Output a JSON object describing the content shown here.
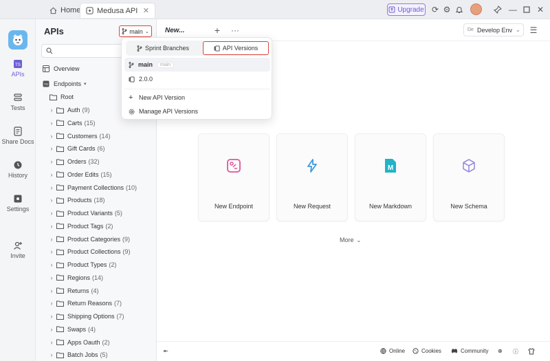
{
  "titlebar": {
    "tabs": [
      {
        "label": "Home",
        "icon": "home-icon"
      },
      {
        "label": "Medusa API",
        "icon": "project-icon",
        "active": true
      }
    ],
    "upgrade_label": "Upgrade"
  },
  "rail": {
    "items": [
      {
        "label": "APIs",
        "icon": "api-icon",
        "active": true
      },
      {
        "label": "Tests",
        "icon": "tests-icon"
      },
      {
        "label": "Share Docs",
        "icon": "docs-icon"
      },
      {
        "label": "History",
        "icon": "history-icon"
      },
      {
        "label": "Settings",
        "icon": "settings-icon"
      },
      {
        "label": "Invite",
        "icon": "invite-icon"
      }
    ]
  },
  "explorer": {
    "title": "APIs",
    "branch_label": "main",
    "overview_label": "Overview",
    "endpoints_label": "Endpoints",
    "root_label": "Root",
    "folders": [
      {
        "name": "Auth",
        "count": "(9)"
      },
      {
        "name": "Carts",
        "count": "(15)"
      },
      {
        "name": "Customers",
        "count": "(14)"
      },
      {
        "name": "Gift Cards",
        "count": "(6)"
      },
      {
        "name": "Orders",
        "count": "(32)"
      },
      {
        "name": "Order Edits",
        "count": "(15)"
      },
      {
        "name": "Payment Collections",
        "count": "(10)"
      },
      {
        "name": "Products",
        "count": "(18)"
      },
      {
        "name": "Product Variants",
        "count": "(5)"
      },
      {
        "name": "Product Tags",
        "count": "(2)"
      },
      {
        "name": "Product Categories",
        "count": "(9)"
      },
      {
        "name": "Product Collections",
        "count": "(9)"
      },
      {
        "name": "Product Types",
        "count": "(2)"
      },
      {
        "name": "Regions",
        "count": "(14)"
      },
      {
        "name": "Returns",
        "count": "(4)"
      },
      {
        "name": "Return Reasons",
        "count": "(7)"
      },
      {
        "name": "Shipping Options",
        "count": "(7)"
      },
      {
        "name": "Swaps",
        "count": "(4)"
      },
      {
        "name": "Apps Oauth",
        "count": "(2)"
      },
      {
        "name": "Batch Jobs",
        "count": "(5)"
      }
    ]
  },
  "dropdown": {
    "tab_branches": "Sprint Branches",
    "tab_versions": "API Versions",
    "items": [
      {
        "label": "main",
        "tag": "main"
      },
      {
        "label": "2.0.0"
      }
    ],
    "actions": [
      {
        "label": "New API Version"
      },
      {
        "label": "Manage API Versions"
      }
    ]
  },
  "main": {
    "tab_label": "New...",
    "env_badge": "De",
    "env_label": "Develop Env",
    "cards": [
      {
        "label": "New Endpoint",
        "color": "#e0569b"
      },
      {
        "label": "New Request",
        "color": "#3b9ad9"
      },
      {
        "label": "New Markdown",
        "color": "#22b3c7"
      },
      {
        "label": "New Schema",
        "color": "#9a8fd8"
      }
    ],
    "more_label": "More"
  },
  "statusbar": {
    "online": "Online",
    "cookies": "Cookies",
    "community": "Community"
  }
}
